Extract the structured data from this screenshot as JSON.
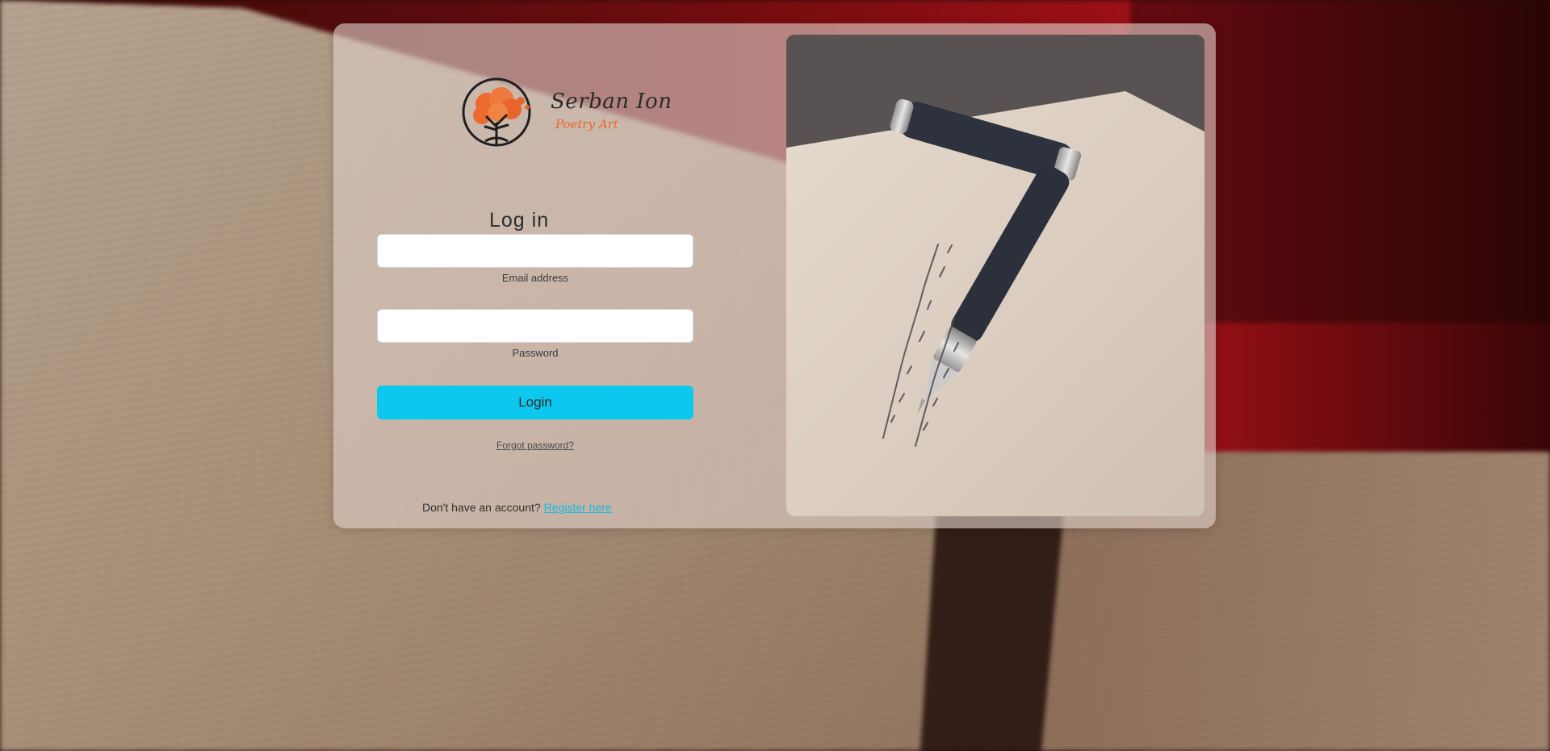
{
  "brand": {
    "name": "Serban Ion",
    "tagline": "Poetry Art"
  },
  "login": {
    "heading": "Log in",
    "email_label": "Email address",
    "email_value": "",
    "password_label": "Password",
    "password_value": "",
    "submit_label": "Login",
    "forgot_label": "Forgot password?",
    "register_prompt": "Don't have an account?",
    "register_link": "Register here"
  },
  "colors": {
    "accent": "#0cc8ef",
    "brand_orange": "#e8662e",
    "link": "#14b9e3"
  },
  "images": {
    "background": "blurred-open-book",
    "side_photo": "fountain-pen-on-handwritten-letter"
  }
}
